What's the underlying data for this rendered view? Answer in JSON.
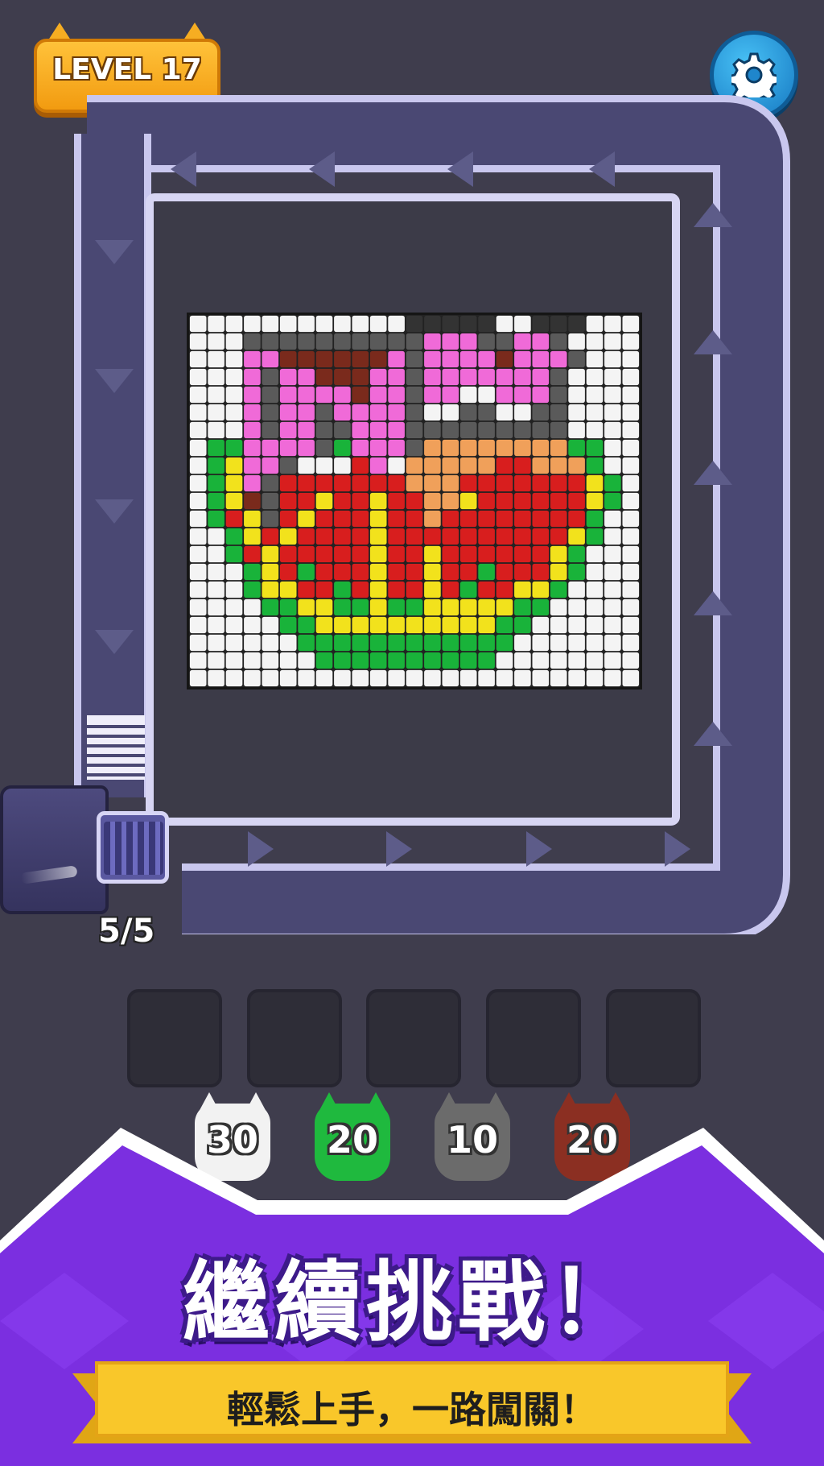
{
  "header": {
    "level_label": "LEVEL 17"
  },
  "settings": {
    "icon": "gear-icon"
  },
  "shooter": {
    "ammo": "5/5"
  },
  "slots": [
    {
      "state": "empty"
    },
    {
      "state": "empty"
    },
    {
      "state": "empty"
    },
    {
      "state": "empty"
    },
    {
      "state": "empty"
    }
  ],
  "cats": [
    {
      "count": "30",
      "color": "#f2f2f2"
    },
    {
      "count": "20",
      "color": "#1fb93e"
    },
    {
      "count": "10",
      "color": "#6b6b6b"
    },
    {
      "count": "20",
      "color": "#8b2f22"
    }
  ],
  "promo": {
    "headline": "繼續挑戰！",
    "subline": "輕鬆上手，一路闖關！"
  },
  "colors": {
    "background": "#3f3d4d",
    "track": "#4a4873",
    "track_border": "#c9c7ee",
    "banner_purple": "#7b2fe0",
    "ribbon_yellow": "#f9c72a"
  }
}
